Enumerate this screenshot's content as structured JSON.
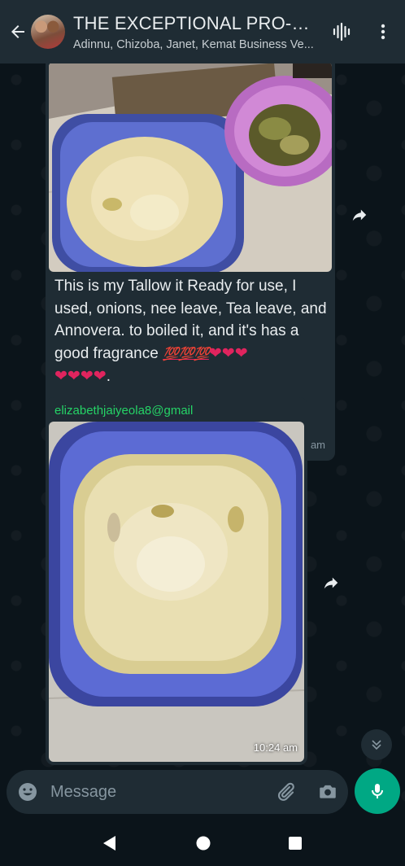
{
  "header": {
    "title": "THE EXCEPTIONAL PRO-FOR...",
    "subtitle": "Adinnu, Chizoba, Janet, Kemat Business Ve...",
    "back_icon": "arrow-left-icon",
    "call_icon": "audio-call-icon",
    "menu_icon": "more-vertical-icon"
  },
  "messages": [
    {
      "type": "image-with-caption",
      "caption_line1": "This is my Tallow it Ready for use, I used, onions, nee leave, Tea leave, and Annovera. to boiled it, and it's has a good fragrance",
      "emoji_hundreds": "💯💯💯",
      "emoji_hearts_a": "❤❤❤",
      "emoji_hearts_b": "❤❤❤❤",
      "trailing": ".",
      "time": "10:24 am"
    },
    {
      "type": "image",
      "sender": "elizabethjaiyeola8@gmail",
      "time": "10:24 am"
    }
  ],
  "composer": {
    "placeholder": "Message",
    "emoji_icon": "emoji-icon",
    "attach_icon": "paperclip-icon",
    "camera_icon": "camera-icon",
    "mic_icon": "microphone-icon"
  },
  "colors": {
    "header_bg": "#1f2c34",
    "chat_bg": "#0b141a",
    "bubble_bg": "#1f2c34",
    "accent": "#00a884",
    "sender_name": "#25d366"
  }
}
